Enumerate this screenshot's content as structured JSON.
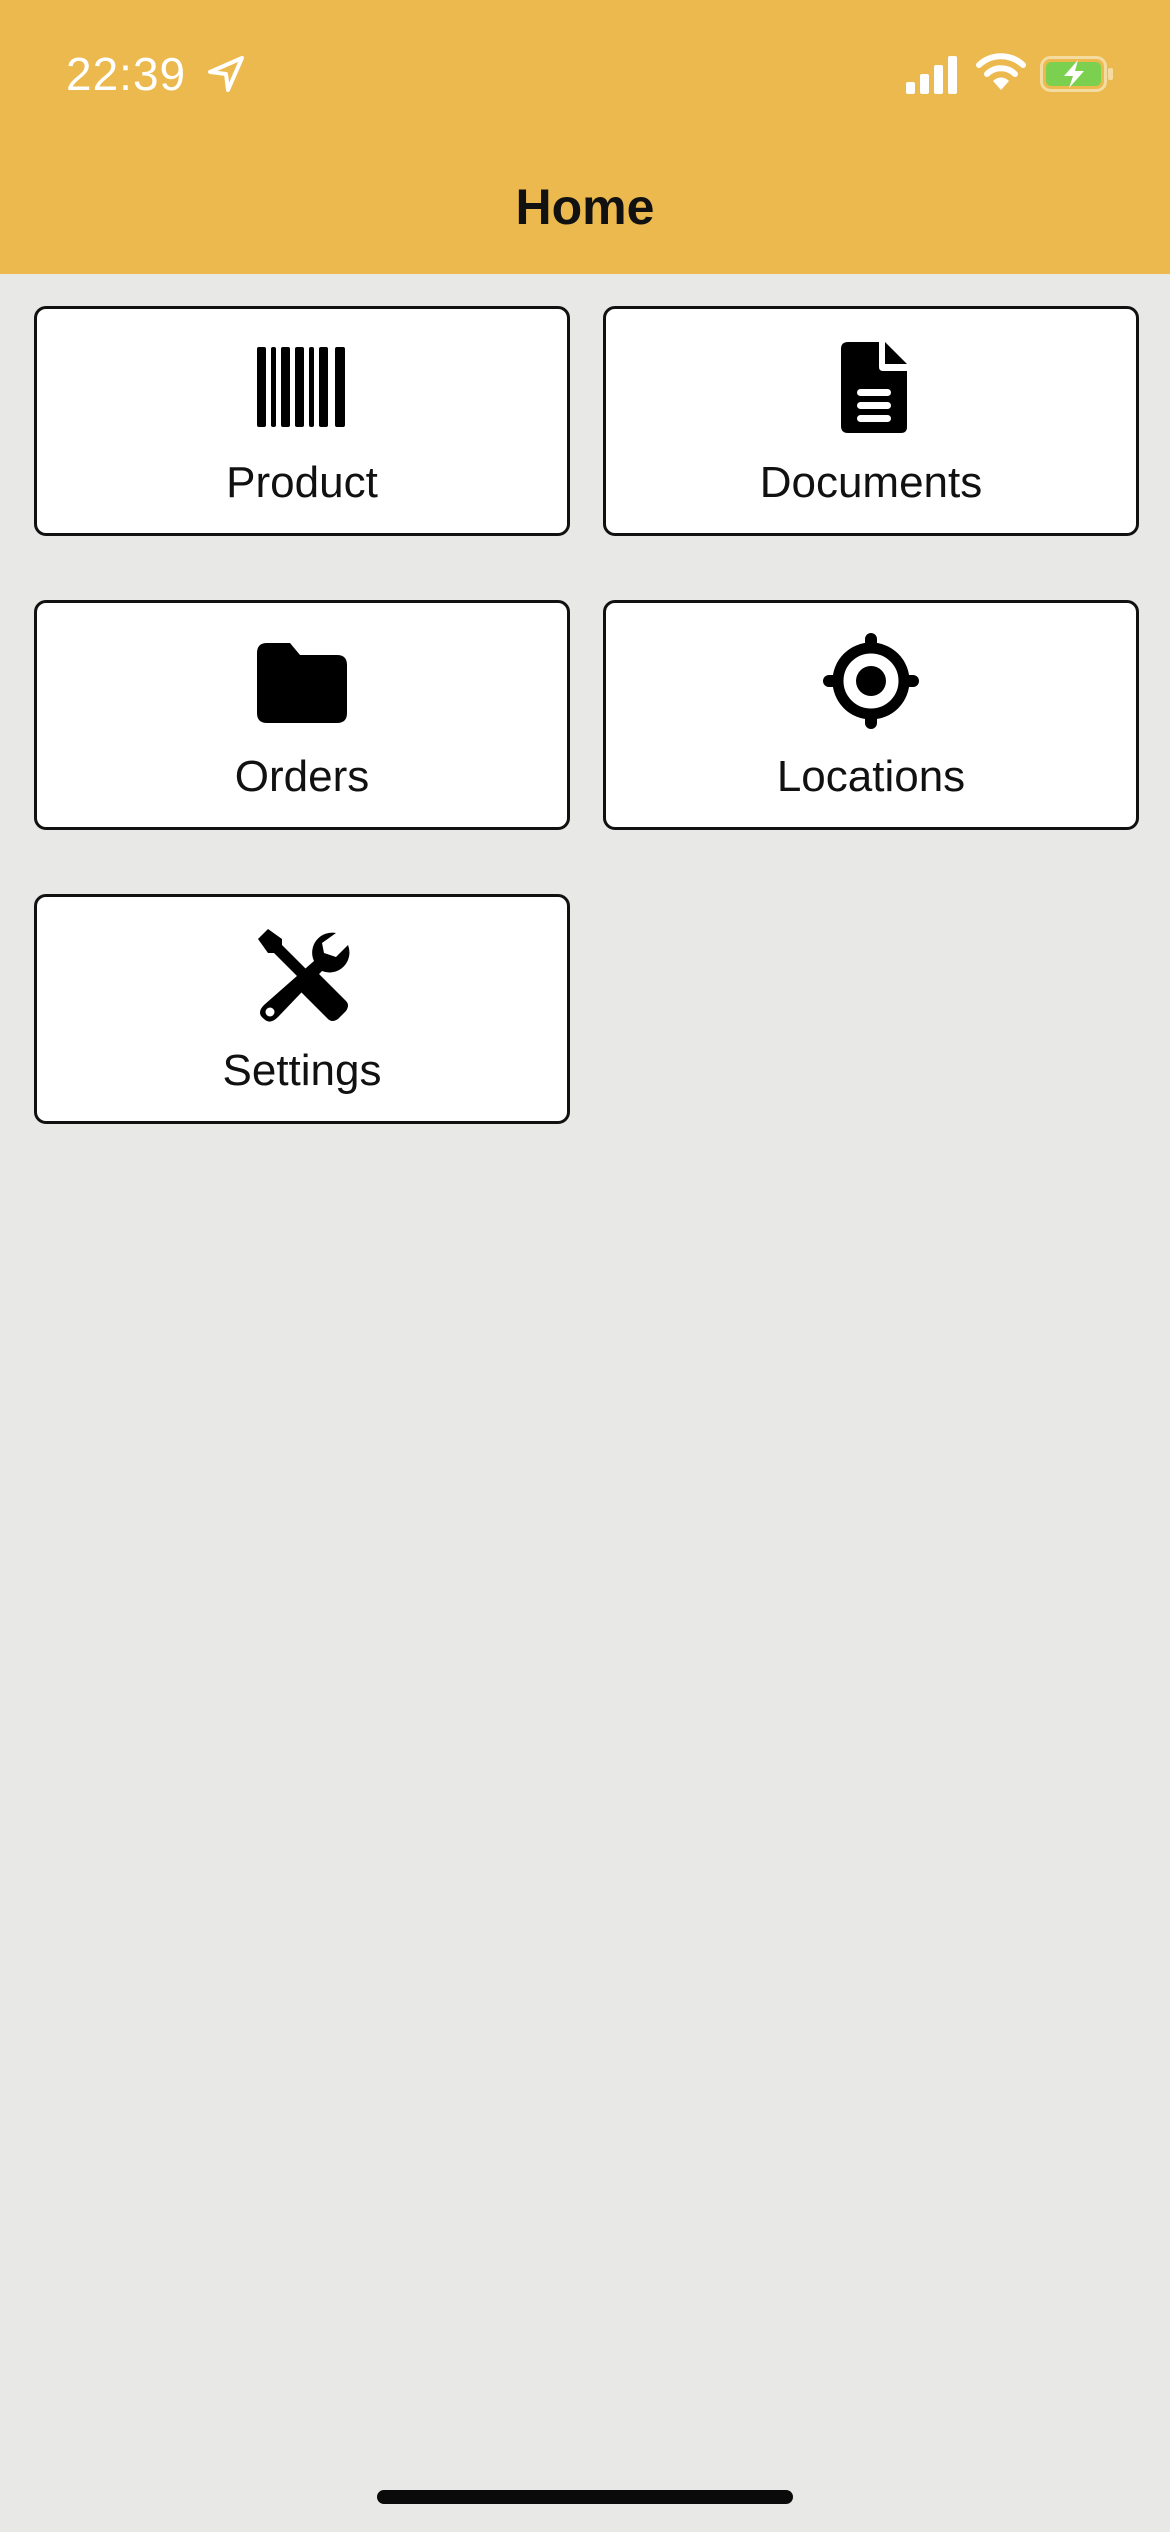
{
  "status_bar": {
    "time": "22:39",
    "icons": [
      "location-arrow-icon",
      "cellular-signal-icon",
      "wifi-icon",
      "battery-charging-icon"
    ]
  },
  "header": {
    "title": "Home",
    "background_color": "#ebb94e"
  },
  "tiles": [
    {
      "label": "Product",
      "icon": "barcode-icon"
    },
    {
      "label": "Documents",
      "icon": "document-icon"
    },
    {
      "label": "Orders",
      "icon": "folder-icon"
    },
    {
      "label": "Locations",
      "icon": "crosshair-icon"
    },
    {
      "label": "Settings",
      "icon": "tools-icon"
    }
  ],
  "colors": {
    "page_background": "#e8e8e7",
    "tile_background": "#ffffff",
    "tile_border": "#111111",
    "battery_fill": "#7bd14f"
  }
}
